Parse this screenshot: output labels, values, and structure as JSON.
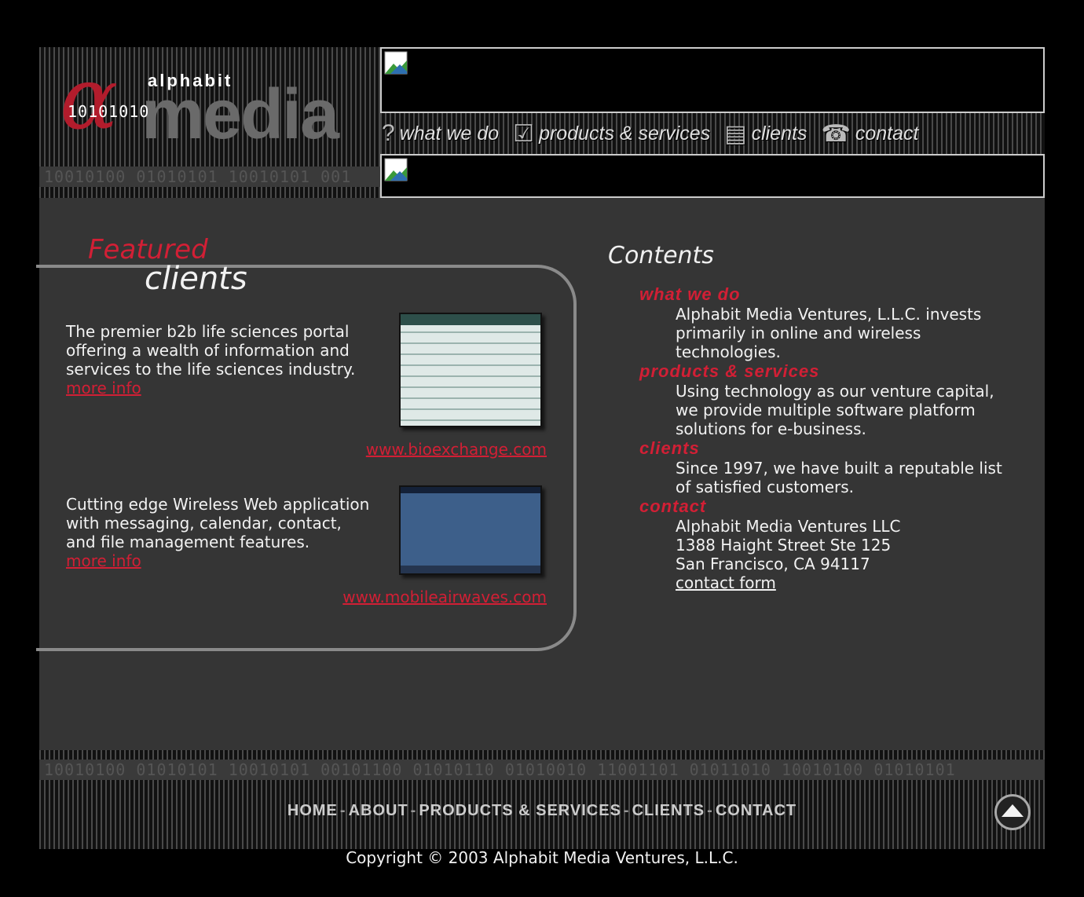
{
  "logo": {
    "alpha": "α",
    "brand": "alphabit",
    "media": "media",
    "binary": "10101010",
    "binary_strip": "10010100 01010101 10010101 001"
  },
  "nav": {
    "items": [
      {
        "icon": "?",
        "label": "what we do"
      },
      {
        "icon": "☑",
        "label": "products & services"
      },
      {
        "icon": "▤",
        "label": "clients"
      },
      {
        "icon": "☎",
        "label": "contact"
      }
    ]
  },
  "featured": {
    "title_1": "Featured",
    "title_2": "clients",
    "clients": [
      {
        "desc": "The premier b2b life sciences portal offering a wealth of information and services to the life sciences industry.",
        "more": "more info",
        "url": "www.bioexchange.com"
      },
      {
        "desc": "Cutting edge Wireless Web application with messaging, calendar, contact, and file management features.",
        "more": "more info",
        "url": "www.mobileairwaves.com"
      }
    ]
  },
  "contents": {
    "title": "Contents",
    "sections": [
      {
        "head": "what we do",
        "lines": [
          "Alphabit Media Ventures, L.L.C. invests",
          "primarily in online and wireless",
          "technologies."
        ]
      },
      {
        "head": "products & services",
        "lines": [
          "Using technology as our venture capital,",
          "we provide multiple software platform",
          "solutions for e-business."
        ]
      },
      {
        "head": "clients",
        "lines": [
          "Since 1997, we have built a reputable list",
          "of satisfied customers."
        ]
      },
      {
        "head": "contact",
        "lines": [
          "Alphabit Media Ventures LLC",
          "1388 Haight Street Ste 125",
          "San Francisco, CA 94117"
        ],
        "link": "contact form"
      }
    ]
  },
  "footer": {
    "binary_strip": "10010100 01010101 10010101 00101100 01010110 01010010 11001101 01011010 10010100 01010101",
    "links": [
      "HOME",
      "ABOUT",
      "PRODUCTS & SERVICES",
      "CLIENTS",
      "CONTACT"
    ],
    "copyright": "Copyright © 2003 Alphabit Media Ventures, L.L.C."
  },
  "colors": {
    "accent": "#d21f35",
    "panel_bg": "#353535",
    "page_bg": "#000000"
  }
}
